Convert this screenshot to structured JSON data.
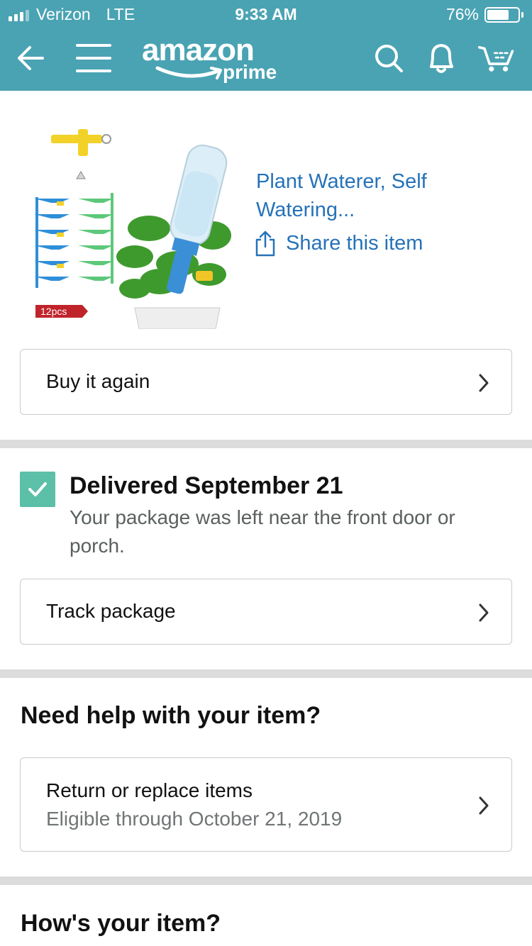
{
  "status_bar": {
    "carrier": "Verizon",
    "network": "LTE",
    "time": "9:33 AM",
    "battery": "76%"
  },
  "header": {
    "logo_main": "amazon",
    "logo_sub": "prime",
    "icons": [
      "back-arrow-icon",
      "menu-icon",
      "search-icon",
      "bell-icon",
      "cart-icon"
    ]
  },
  "product": {
    "image_badge": "12pcs",
    "title_line1": "Plant Waterer, Self",
    "title_line2": "Watering...",
    "share_label": "Share this item"
  },
  "actions": {
    "buy_again": "Buy it again",
    "track_package": "Track package"
  },
  "delivery": {
    "title": "Delivered September 21",
    "message": "Your package was left near the front door or porch."
  },
  "help": {
    "heading": "Need help with your item?",
    "return_label": "Return or replace items",
    "return_sub": "Eligible through October 21, 2019"
  },
  "review": {
    "heading": "How's your item?"
  },
  "colors": {
    "header": "#4aa3b3",
    "link": "#2672b8",
    "check": "#5cbfa8",
    "divider": "#dcdcdc"
  }
}
